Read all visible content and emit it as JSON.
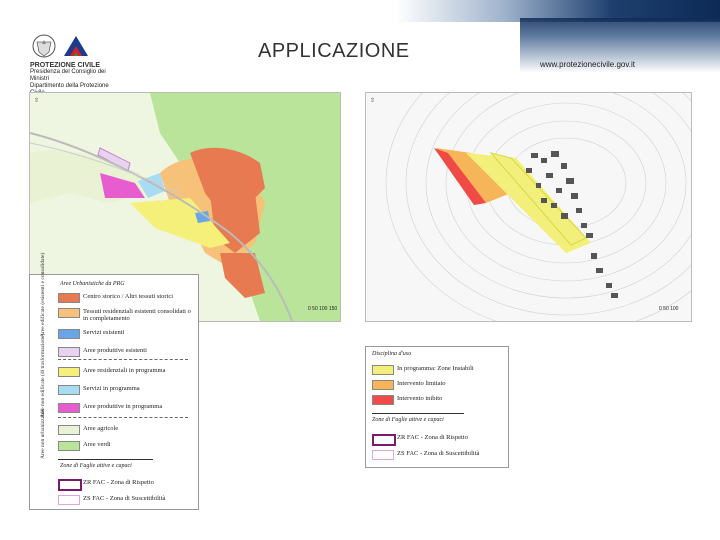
{
  "header": {
    "title": "APPLICAZIONE",
    "url": "www.protezionecivile.gov.it",
    "logo_lines": [
      "PROTEZIONE CIVILE",
      "Presidenza del Consiglio dei Ministri",
      "Dipartimento della Protezione Civile"
    ]
  },
  "colors": {
    "accent": "#0d2a55",
    "centro_storico": "#e87a52",
    "tessuto": "#f6c27a",
    "servizi": "#6aa5e8",
    "produttive": "#e8d2f0",
    "residenziali_prog": "#f5f07a",
    "servizi_prog": "#a8dcf3",
    "produttive_prog": "#e75dd0",
    "agricole": "#eaf2d5",
    "verdi": "#b9e49a",
    "instabile": "#f2f07a",
    "limitato": "#f7b55a",
    "inibito": "#f04a47"
  },
  "legend_left": {
    "title": "Aree Urbanistiche da PRG",
    "group_1": "Aree edificate (esistenti e consolidate)",
    "group_2": "Aree non edificate (di trasformazione)",
    "group_3": "Aree non urbanizzabili",
    "items": [
      {
        "label": "Centro storico / Altri tessuti storici"
      },
      {
        "label": "Tessuti residenziali esistenti consolidati o in completamento"
      },
      {
        "label": "Servizi esistenti"
      },
      {
        "label": "Aree produttive esistenti"
      },
      {
        "label": "Aree residenziali in programma"
      },
      {
        "label": "Servizi in programma"
      },
      {
        "label": "Aree produttive in programma"
      },
      {
        "label": "Aree agricole"
      },
      {
        "label": "Aree verdi"
      }
    ],
    "zone_title": "Zone di Faglie attive e capaci",
    "zone_items": [
      {
        "label": "ZR FAC - Zona di Rispetto"
      },
      {
        "label": "ZS FAC - Zona di Suscettibilità"
      }
    ]
  },
  "legend_right": {
    "title": "Disciplina d'uso",
    "items": [
      {
        "label": "In programma: Zone Instabili"
      },
      {
        "label": "Intervento limitato"
      },
      {
        "label": "Intervento inibito"
      }
    ],
    "zone_title": "Zone di Faglie attive e capaci",
    "zone_items": [
      {
        "label": "ZR FAC - Zona di Rispetto"
      },
      {
        "label": "ZS FAC - Zona di Suscettibilità"
      }
    ]
  },
  "map_left": {
    "scale": [
      "0",
      "50",
      "100",
      "150"
    ]
  },
  "map_right": {
    "scale": [
      "0",
      "50",
      "100"
    ]
  }
}
